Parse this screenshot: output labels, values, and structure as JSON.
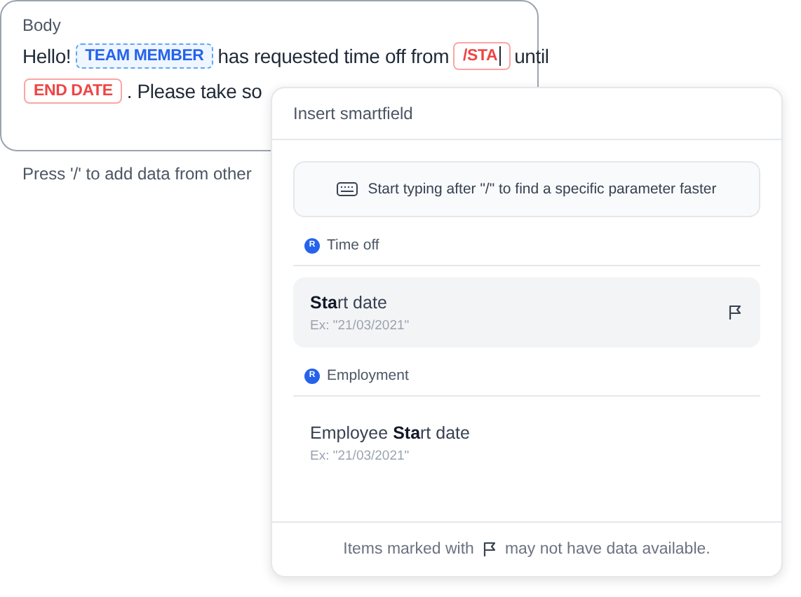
{
  "editor": {
    "label": "Body",
    "content": [
      {
        "kind": "text",
        "text": "Hello!"
      },
      {
        "kind": "token",
        "text": "TEAM MEMBER"
      },
      {
        "kind": "text",
        "text": "has requested time off from"
      },
      {
        "kind": "invalid",
        "text": "/STA",
        "cursor": true
      },
      {
        "kind": "text",
        "text": "until"
      },
      {
        "kind": "invalid",
        "text": "END DATE",
        "cursor": false
      },
      {
        "kind": "text",
        "text": ". Please take so"
      }
    ],
    "hint": "Press '/' to add data from other"
  },
  "popup": {
    "title": "Insert smartfield",
    "tip": "Start typing after \"/\" to find a specific parameter faster",
    "groups": [
      {
        "badge": "R",
        "name": "Time off",
        "items": [
          {
            "label": "**Sta**rt date",
            "example": "Ex: \"21/03/2021\"",
            "selected": true,
            "flagged": true
          }
        ]
      },
      {
        "badge": "R",
        "name": "Employment",
        "items": [
          {
            "label": "Employee **Sta**rt date",
            "example": "Ex: \"21/03/2021\"",
            "selected": false,
            "flagged": false
          }
        ]
      }
    ],
    "footer": {
      "before": "Items marked with",
      "after": "may not have data available."
    }
  }
}
